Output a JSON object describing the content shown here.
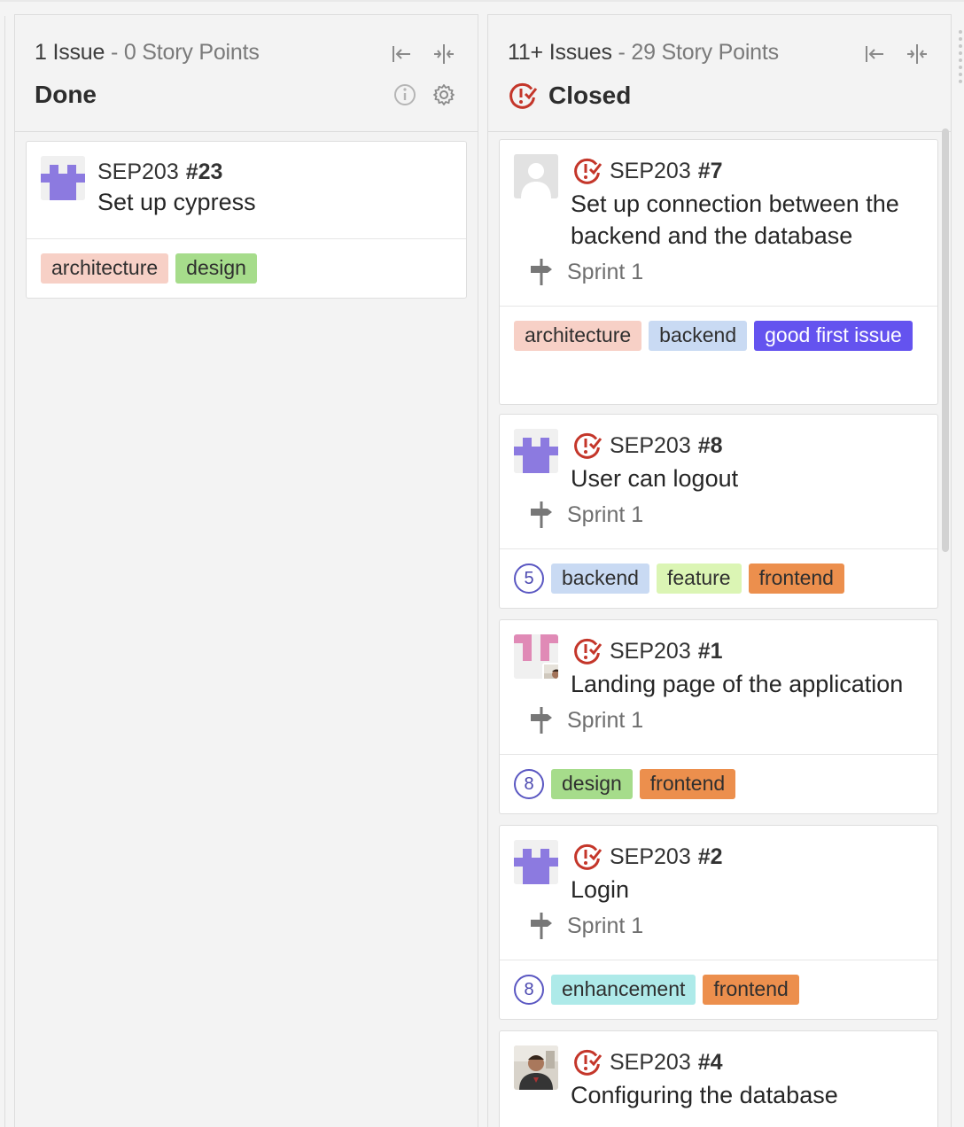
{
  "colors": {
    "architecture": "#f7d0c6",
    "backend": "#c9daf3",
    "design": "#a6dc8b",
    "feature": "#dbf5b4",
    "frontend": "#ec8f4d",
    "good_first_issue": "#6453ef",
    "enhancement": "#aeeae9",
    "closed_icon": "#c4362a"
  },
  "columns": {
    "done": {
      "count": "1 Issue",
      "separator": " - ",
      "points": "0 Story Points",
      "title": "Done",
      "icons": [
        "collapse-left-icon",
        "collapse-icon",
        "info-icon",
        "gear-icon"
      ]
    },
    "closed": {
      "count": "11+ Issues",
      "separator": " - ",
      "points": "29 Story Points",
      "title": "Closed",
      "icons": [
        "closed-issue-icon",
        "collapse-left-icon",
        "collapse-icon"
      ]
    }
  },
  "cards": {
    "c23": {
      "repo": "SEP203",
      "number": "#23",
      "title": "Set up cypress",
      "labels": [
        "architecture",
        "design"
      ]
    },
    "c7": {
      "repo": "SEP203",
      "number": "#7",
      "title_line1": "Set up connection between the",
      "title_line2": "backend and the database",
      "sprint": "Sprint 1",
      "labels": [
        "architecture",
        "backend",
        "good first issue"
      ]
    },
    "c8": {
      "repo": "SEP203",
      "number": "#8",
      "title": "User can logout",
      "sprint": "Sprint 1",
      "points": "5",
      "labels": [
        "backend",
        "feature",
        "frontend"
      ]
    },
    "c1": {
      "repo": "SEP203",
      "number": "#1",
      "title": "Landing page of the application",
      "sprint": "Sprint 1",
      "points": "8",
      "labels": [
        "design",
        "frontend"
      ]
    },
    "c2": {
      "repo": "SEP203",
      "number": "#2",
      "title": "Login",
      "sprint": "Sprint 1",
      "points": "8",
      "labels": [
        "enhancement",
        "frontend"
      ]
    },
    "c4": {
      "repo": "SEP203",
      "number": "#4",
      "title": "Configuring the database"
    }
  }
}
